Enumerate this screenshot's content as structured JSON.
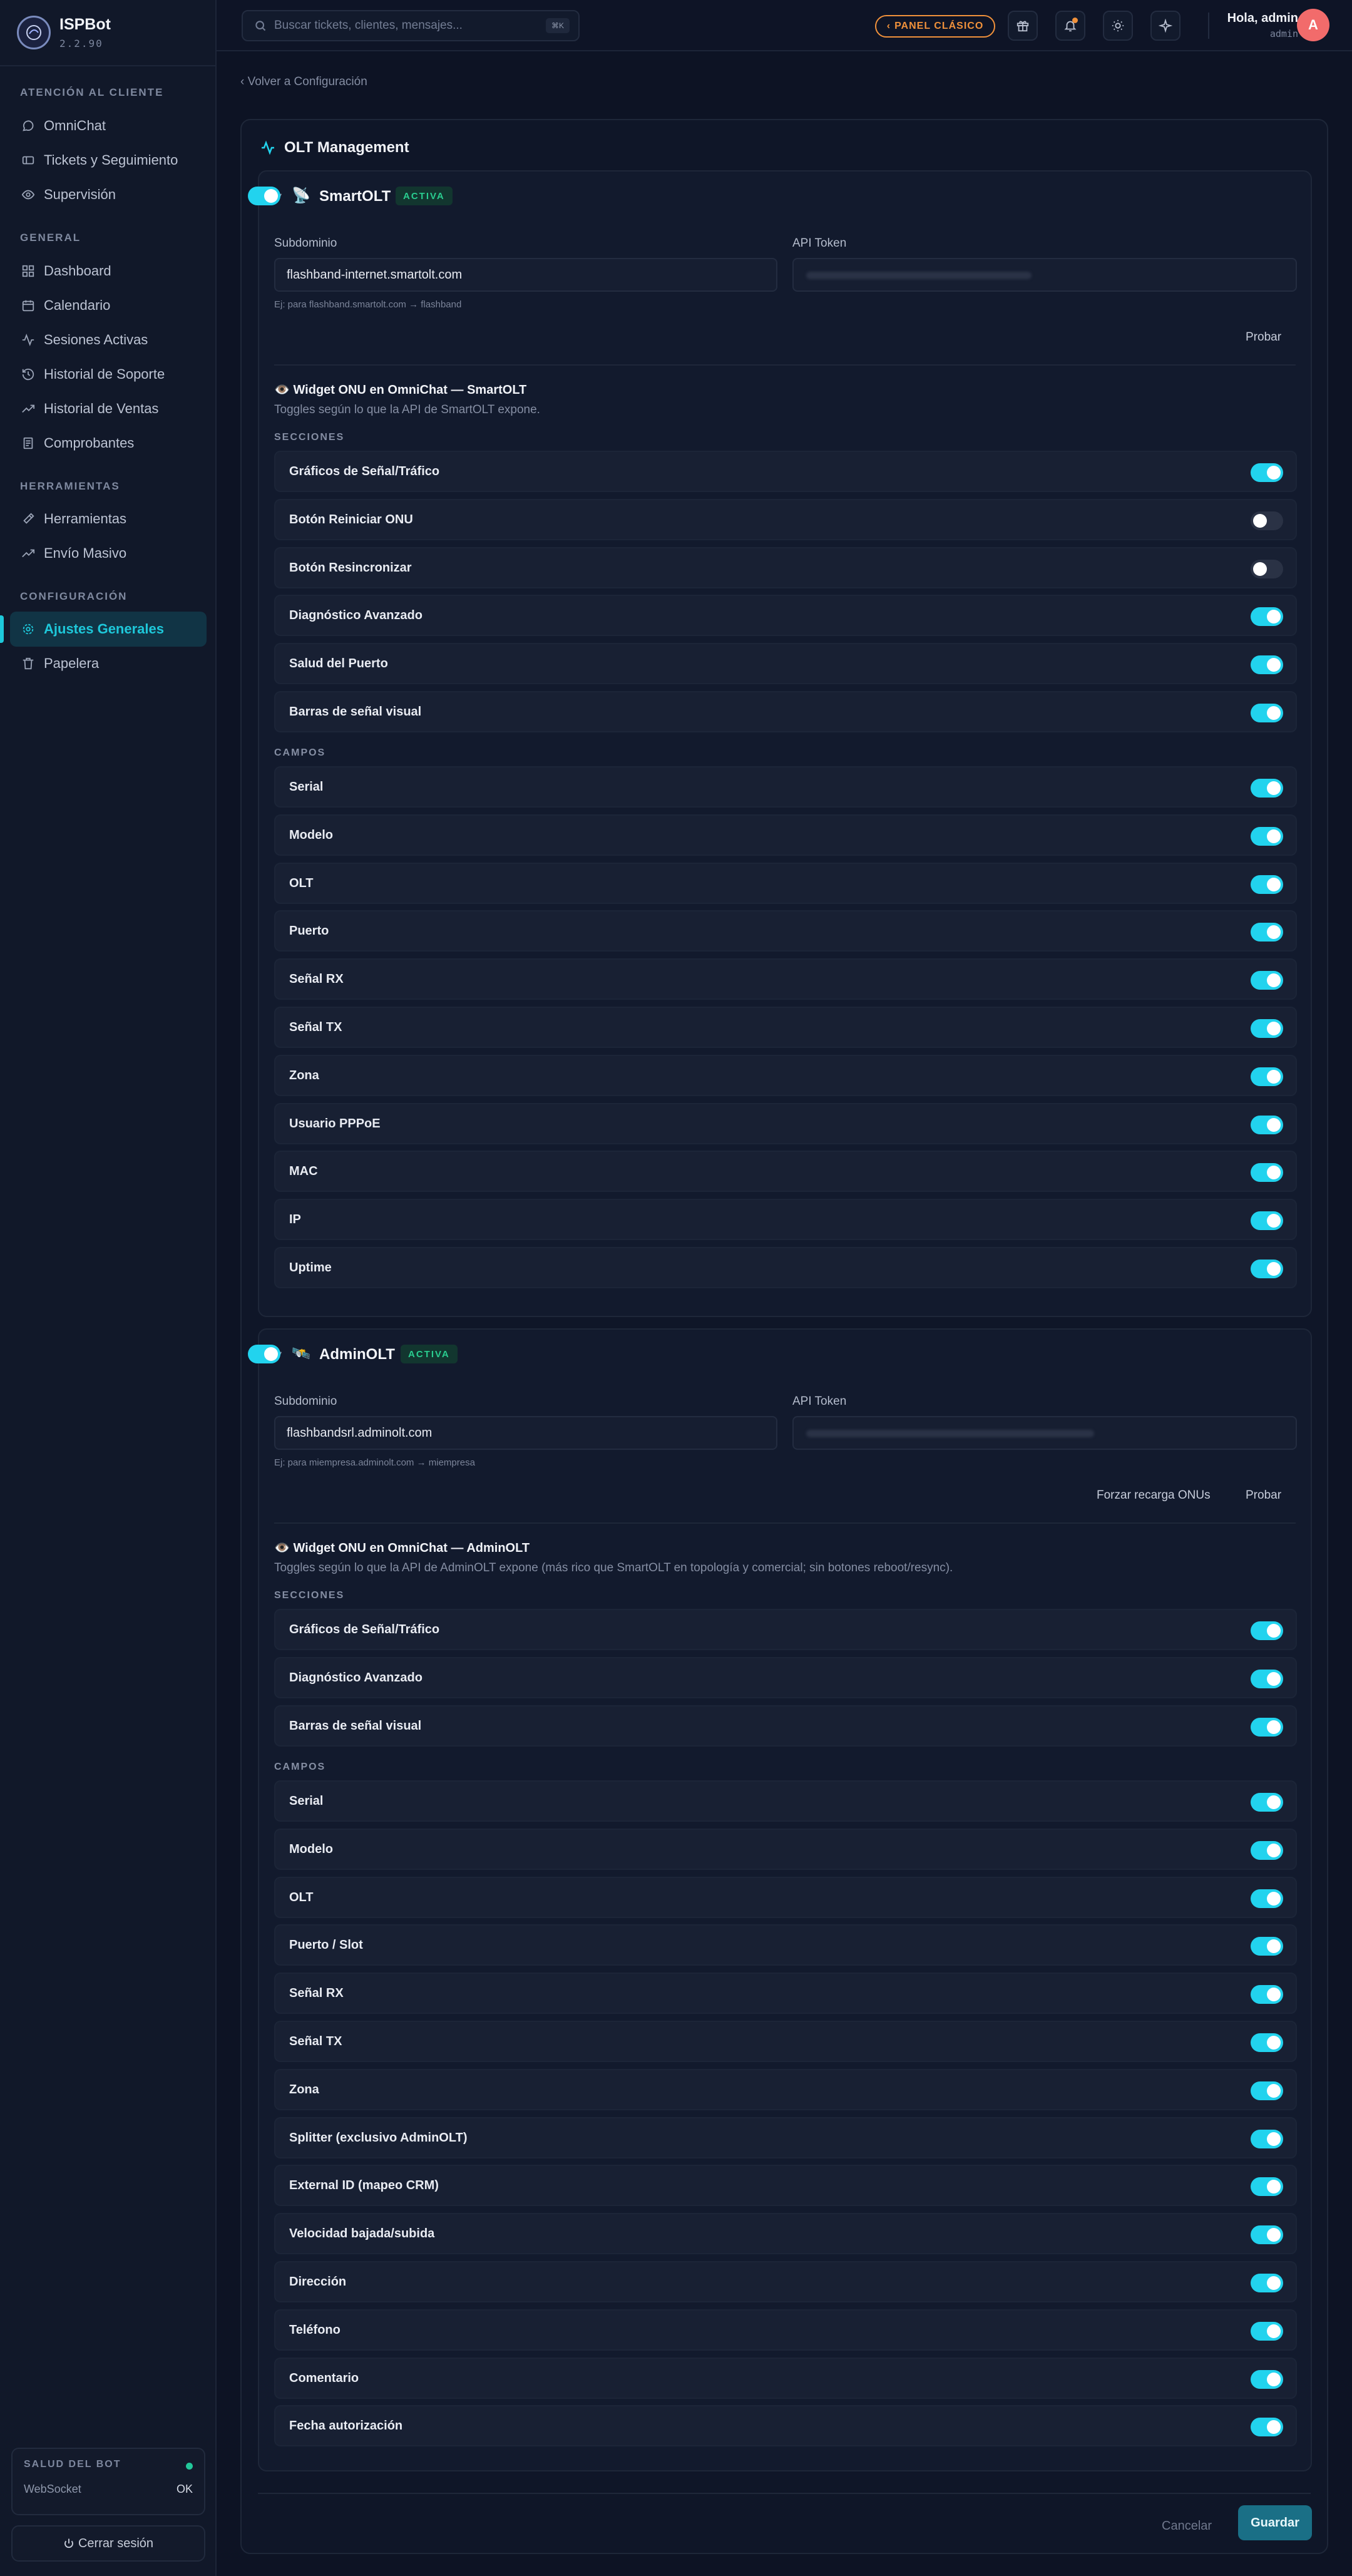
{
  "app": {
    "name": "ISPBot",
    "version": "2.2.90"
  },
  "sidebar": {
    "sections": [
      {
        "title": "ATENCIÓN AL CLIENTE",
        "items": [
          {
            "label": "OmniChat",
            "icon": "chat-icon"
          },
          {
            "label": "Tickets y Seguimiento",
            "icon": "ticket-icon"
          },
          {
            "label": "Supervisión",
            "icon": "eye-icon"
          }
        ]
      },
      {
        "title": "GENERAL",
        "items": [
          {
            "label": "Dashboard",
            "icon": "grid-icon"
          },
          {
            "label": "Calendario",
            "icon": "calendar-icon"
          },
          {
            "label": "Sesiones Activas",
            "icon": "activity-icon"
          },
          {
            "label": "Historial de Soporte",
            "icon": "history-icon"
          },
          {
            "label": "Historial de Ventas",
            "icon": "trending-icon"
          },
          {
            "label": "Comprobantes",
            "icon": "receipt-icon"
          }
        ]
      },
      {
        "title": "HERRAMIENTAS",
        "items": [
          {
            "label": "Herramientas",
            "icon": "hammer-icon"
          },
          {
            "label": "Envío Masivo",
            "icon": "trending-icon"
          }
        ]
      },
      {
        "title": "CONFIGURACIÓN",
        "items": [
          {
            "label": "Ajustes Generales",
            "icon": "gear-icon",
            "active": true
          },
          {
            "label": "Papelera",
            "icon": "trash-icon"
          }
        ]
      }
    ],
    "health": {
      "title": "SALUD DEL BOT",
      "websocket_label": "WebSocket",
      "websocket_value": "OK",
      "status_color": "#22c79a"
    },
    "logout_label": "Cerrar sesión"
  },
  "header": {
    "search_placeholder": "Buscar tickets, clientes, mensajes...",
    "search_shortcut": "⌘K",
    "classic_panel_label": "PANEL CLÁSICO",
    "greeting": "Hola, admin",
    "role": "admin",
    "avatar_initial": "A"
  },
  "main": {
    "back_link": "‹ Volver a Configuración",
    "card_title": "OLT Management",
    "cancel_label": "Cancelar",
    "save_label": "Guardar"
  },
  "smartolt": {
    "name": "SmartOLT",
    "badge": "ACTIVA",
    "enabled": true,
    "subdomain_label": "Subdominio",
    "subdomain_value": "flashband-internet.smartolt.com",
    "subdomain_hint": "Ej: para flashband.smartolt.com → flashband",
    "token_label": "API Token",
    "test_label": "Probar",
    "widget_title": "Widget ONU en OmniChat — SmartOLT",
    "widget_subtitle": "Toggles según lo que la API de SmartOLT expone.",
    "sections_label": "SECCIONES",
    "fields_label": "CAMPOS",
    "sections": [
      {
        "label": "Gráficos de Señal/Tráfico",
        "on": true
      },
      {
        "label": "Botón Reiniciar ONU",
        "on": false
      },
      {
        "label": "Botón Resincronizar",
        "on": false
      },
      {
        "label": "Diagnóstico Avanzado",
        "on": true
      },
      {
        "label": "Salud del Puerto",
        "on": true
      },
      {
        "label": "Barras de señal visual",
        "on": true
      }
    ],
    "fields": [
      {
        "label": "Serial",
        "on": true
      },
      {
        "label": "Modelo",
        "on": true
      },
      {
        "label": "OLT",
        "on": true
      },
      {
        "label": "Puerto",
        "on": true
      },
      {
        "label": "Señal RX",
        "on": true
      },
      {
        "label": "Señal TX",
        "on": true
      },
      {
        "label": "Zona",
        "on": true
      },
      {
        "label": "Usuario PPPoE",
        "on": true
      },
      {
        "label": "MAC",
        "on": true
      },
      {
        "label": "IP",
        "on": true
      },
      {
        "label": "Uptime",
        "on": true
      }
    ]
  },
  "adminolt": {
    "name": "AdminOLT",
    "badge": "ACTIVA",
    "enabled": true,
    "subdomain_label": "Subdominio",
    "subdomain_value": "flashbandsrl.adminolt.com",
    "subdomain_hint": "Ej: para miempresa.adminolt.com → miempresa",
    "token_label": "API Token",
    "reload_label": "Forzar recarga ONUs",
    "test_label": "Probar",
    "widget_title": "Widget ONU en OmniChat — AdminOLT",
    "widget_subtitle": "Toggles según lo que la API de AdminOLT expone (más rico que SmartOLT en topología y comercial; sin botones reboot/resync).",
    "sections_label": "SECCIONES",
    "fields_label": "CAMPOS",
    "sections": [
      {
        "label": "Gráficos de Señal/Tráfico",
        "on": true
      },
      {
        "label": "Diagnóstico Avanzado",
        "on": true
      },
      {
        "label": "Barras de señal visual",
        "on": true
      }
    ],
    "fields": [
      {
        "label": "Serial",
        "on": true
      },
      {
        "label": "Modelo",
        "on": true
      },
      {
        "label": "OLT",
        "on": true
      },
      {
        "label": "Puerto / Slot",
        "on": true
      },
      {
        "label": "Señal RX",
        "on": true
      },
      {
        "label": "Señal TX",
        "on": true
      },
      {
        "label": "Zona",
        "on": true
      },
      {
        "label": "Splitter (exclusivo AdminOLT)",
        "on": true
      },
      {
        "label": "External ID (mapeo CRM)",
        "on": true
      },
      {
        "label": "Velocidad bajada/subida",
        "on": true
      },
      {
        "label": "Dirección",
        "on": true
      },
      {
        "label": "Teléfono",
        "on": true
      },
      {
        "label": "Comentario",
        "on": true
      },
      {
        "label": "Fecha autorización",
        "on": true
      }
    ]
  },
  "colors": {
    "accent": "#22d3ee",
    "warning": "#f0913b",
    "success": "#29cc8f",
    "save": "#1a6f86"
  }
}
